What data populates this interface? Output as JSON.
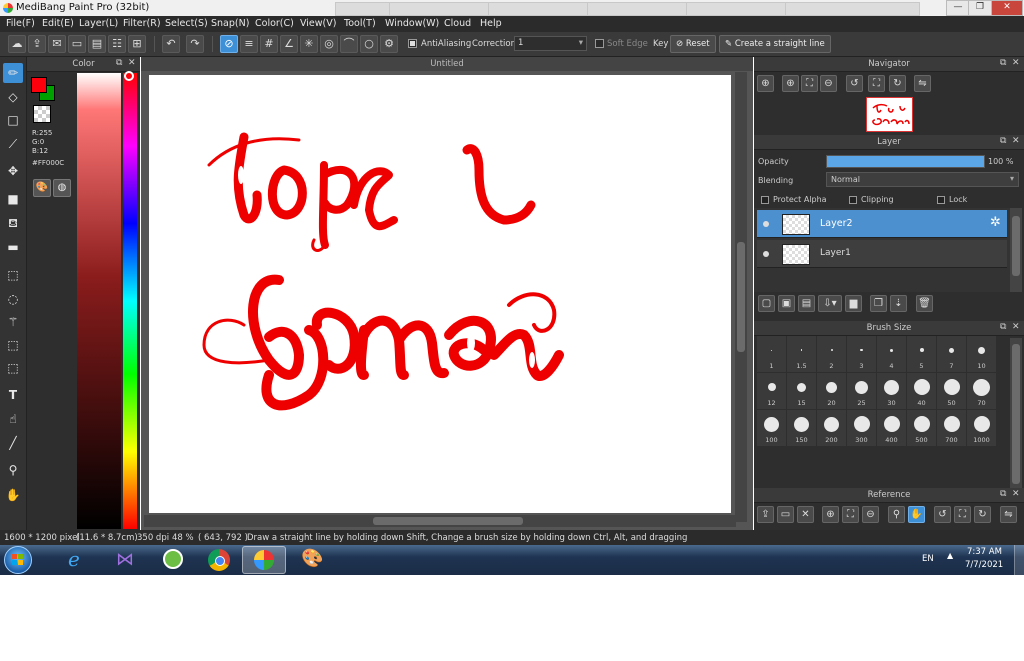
{
  "window": {
    "title": "MediBang Paint Pro (32bit)",
    "bg_tabs": [
      "",
      "",
      "",
      "",
      "",
      ""
    ],
    "controls": [
      "—",
      "❐",
      "✕"
    ]
  },
  "menu": {
    "items": [
      "File(F)",
      "Edit(E)",
      "Layer(L)",
      "Filter(R)",
      "Select(S)",
      "Snap(N)",
      "Color(C)",
      "View(V)",
      "Tool(T)",
      "Window(W)",
      "Cloud",
      "Help"
    ]
  },
  "toolbar": {
    "antialiasing_label": "AntiAliasing",
    "correction_label": "Correction",
    "correction_value": "1",
    "soft_edge_label": "Soft Edge",
    "key_label": "Key",
    "reset_label": "Reset",
    "straight_line_label": "Create a straight line"
  },
  "color_panel": {
    "title": "Color",
    "fg_color": "#FF000C",
    "bg_color": "#00A000",
    "r": "R:255",
    "g": "G:0",
    "b": "B:12",
    "hex": "#FF000C"
  },
  "canvas": {
    "tab_title": "Untitled",
    "drawing_text_line1": "top 1",
    "drawing_text_line2": "Gamer",
    "ink_color": "#ee0000"
  },
  "navigator": {
    "title": "Navigator"
  },
  "layer_panel": {
    "title": "Layer",
    "opacity_label": "Opacity",
    "opacity_value": "100 %",
    "opacity_fraction": 1.0,
    "blending_label": "Blending",
    "blending_value": "Normal",
    "protect_alpha_label": "Protect Alpha",
    "clipping_label": "Clipping",
    "lock_label": "Lock",
    "layers": [
      {
        "name": "Layer2",
        "selected": true
      },
      {
        "name": "Layer1",
        "selected": false
      }
    ]
  },
  "brush_size": {
    "title": "Brush Size",
    "sizes": [
      "1",
      "1.5",
      "2",
      "3",
      "4",
      "5",
      "7",
      "10",
      "12",
      "15",
      "20",
      "25",
      "30",
      "40",
      "50",
      "70",
      "100",
      "150",
      "200",
      "300",
      "400",
      "500",
      "700",
      "1000"
    ]
  },
  "reference": {
    "title": "Reference"
  },
  "status": {
    "image_size": "1600 * 1200 pixel",
    "physical_size": "(11.6 * 8.7cm)",
    "dpi": "350 dpi",
    "zoom": "48 %",
    "cursor": "( 643, 792 )",
    "hint": "Draw a straight line by holding down Shift, Change a brush size by holding down Ctrl, Alt, and dragging"
  },
  "taskbar": {
    "language": "EN",
    "time": "7:37 AM",
    "date": "7/7/2021"
  }
}
